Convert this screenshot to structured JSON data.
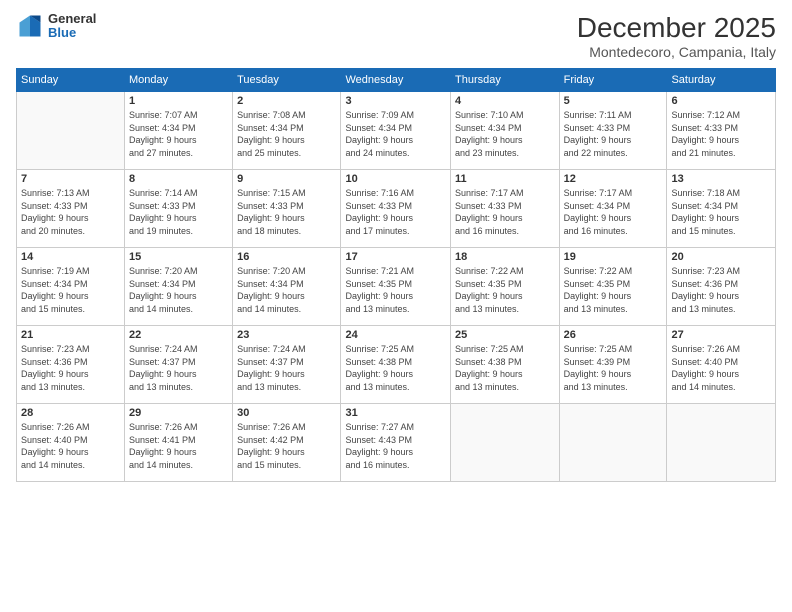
{
  "logo": {
    "general": "General",
    "blue": "Blue"
  },
  "header": {
    "month": "December 2025",
    "location": "Montedecoro, Campania, Italy"
  },
  "weekdays": [
    "Sunday",
    "Monday",
    "Tuesday",
    "Wednesday",
    "Thursday",
    "Friday",
    "Saturday"
  ],
  "weeks": [
    [
      {
        "day": "",
        "info": ""
      },
      {
        "day": "1",
        "info": "Sunrise: 7:07 AM\nSunset: 4:34 PM\nDaylight: 9 hours\nand 27 minutes."
      },
      {
        "day": "2",
        "info": "Sunrise: 7:08 AM\nSunset: 4:34 PM\nDaylight: 9 hours\nand 25 minutes."
      },
      {
        "day": "3",
        "info": "Sunrise: 7:09 AM\nSunset: 4:34 PM\nDaylight: 9 hours\nand 24 minutes."
      },
      {
        "day": "4",
        "info": "Sunrise: 7:10 AM\nSunset: 4:34 PM\nDaylight: 9 hours\nand 23 minutes."
      },
      {
        "day": "5",
        "info": "Sunrise: 7:11 AM\nSunset: 4:33 PM\nDaylight: 9 hours\nand 22 minutes."
      },
      {
        "day": "6",
        "info": "Sunrise: 7:12 AM\nSunset: 4:33 PM\nDaylight: 9 hours\nand 21 minutes."
      }
    ],
    [
      {
        "day": "7",
        "info": "Sunrise: 7:13 AM\nSunset: 4:33 PM\nDaylight: 9 hours\nand 20 minutes."
      },
      {
        "day": "8",
        "info": "Sunrise: 7:14 AM\nSunset: 4:33 PM\nDaylight: 9 hours\nand 19 minutes."
      },
      {
        "day": "9",
        "info": "Sunrise: 7:15 AM\nSunset: 4:33 PM\nDaylight: 9 hours\nand 18 minutes."
      },
      {
        "day": "10",
        "info": "Sunrise: 7:16 AM\nSunset: 4:33 PM\nDaylight: 9 hours\nand 17 minutes."
      },
      {
        "day": "11",
        "info": "Sunrise: 7:17 AM\nSunset: 4:33 PM\nDaylight: 9 hours\nand 16 minutes."
      },
      {
        "day": "12",
        "info": "Sunrise: 7:17 AM\nSunset: 4:34 PM\nDaylight: 9 hours\nand 16 minutes."
      },
      {
        "day": "13",
        "info": "Sunrise: 7:18 AM\nSunset: 4:34 PM\nDaylight: 9 hours\nand 15 minutes."
      }
    ],
    [
      {
        "day": "14",
        "info": "Sunrise: 7:19 AM\nSunset: 4:34 PM\nDaylight: 9 hours\nand 15 minutes."
      },
      {
        "day": "15",
        "info": "Sunrise: 7:20 AM\nSunset: 4:34 PM\nDaylight: 9 hours\nand 14 minutes."
      },
      {
        "day": "16",
        "info": "Sunrise: 7:20 AM\nSunset: 4:34 PM\nDaylight: 9 hours\nand 14 minutes."
      },
      {
        "day": "17",
        "info": "Sunrise: 7:21 AM\nSunset: 4:35 PM\nDaylight: 9 hours\nand 13 minutes."
      },
      {
        "day": "18",
        "info": "Sunrise: 7:22 AM\nSunset: 4:35 PM\nDaylight: 9 hours\nand 13 minutes."
      },
      {
        "day": "19",
        "info": "Sunrise: 7:22 AM\nSunset: 4:35 PM\nDaylight: 9 hours\nand 13 minutes."
      },
      {
        "day": "20",
        "info": "Sunrise: 7:23 AM\nSunset: 4:36 PM\nDaylight: 9 hours\nand 13 minutes."
      }
    ],
    [
      {
        "day": "21",
        "info": "Sunrise: 7:23 AM\nSunset: 4:36 PM\nDaylight: 9 hours\nand 13 minutes."
      },
      {
        "day": "22",
        "info": "Sunrise: 7:24 AM\nSunset: 4:37 PM\nDaylight: 9 hours\nand 13 minutes."
      },
      {
        "day": "23",
        "info": "Sunrise: 7:24 AM\nSunset: 4:37 PM\nDaylight: 9 hours\nand 13 minutes."
      },
      {
        "day": "24",
        "info": "Sunrise: 7:25 AM\nSunset: 4:38 PM\nDaylight: 9 hours\nand 13 minutes."
      },
      {
        "day": "25",
        "info": "Sunrise: 7:25 AM\nSunset: 4:38 PM\nDaylight: 9 hours\nand 13 minutes."
      },
      {
        "day": "26",
        "info": "Sunrise: 7:25 AM\nSunset: 4:39 PM\nDaylight: 9 hours\nand 13 minutes."
      },
      {
        "day": "27",
        "info": "Sunrise: 7:26 AM\nSunset: 4:40 PM\nDaylight: 9 hours\nand 14 minutes."
      }
    ],
    [
      {
        "day": "28",
        "info": "Sunrise: 7:26 AM\nSunset: 4:40 PM\nDaylight: 9 hours\nand 14 minutes."
      },
      {
        "day": "29",
        "info": "Sunrise: 7:26 AM\nSunset: 4:41 PM\nDaylight: 9 hours\nand 14 minutes."
      },
      {
        "day": "30",
        "info": "Sunrise: 7:26 AM\nSunset: 4:42 PM\nDaylight: 9 hours\nand 15 minutes."
      },
      {
        "day": "31",
        "info": "Sunrise: 7:27 AM\nSunset: 4:43 PM\nDaylight: 9 hours\nand 16 minutes."
      },
      {
        "day": "",
        "info": ""
      },
      {
        "day": "",
        "info": ""
      },
      {
        "day": "",
        "info": ""
      }
    ]
  ]
}
